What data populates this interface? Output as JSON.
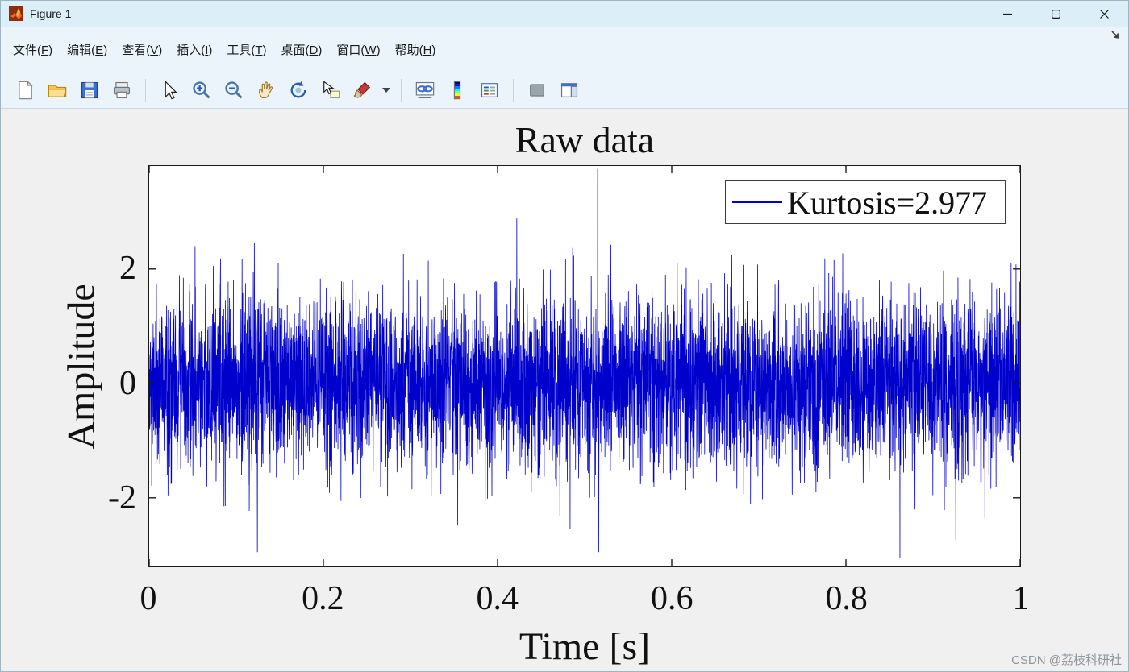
{
  "window": {
    "title": "Figure 1",
    "control_icons": [
      "minimize-icon",
      "maximize-icon",
      "close-icon"
    ],
    "app_icon": "matlab-logo-icon"
  },
  "menu": {
    "items": [
      {
        "pre": "文件(",
        "key": "F",
        "post": ")"
      },
      {
        "pre": "编辑(",
        "key": "E",
        "post": ")"
      },
      {
        "pre": "查看(",
        "key": "V",
        "post": ")"
      },
      {
        "pre": "插入(",
        "key": "I",
        "post": ")"
      },
      {
        "pre": "工具(",
        "key": "T",
        "post": ")"
      },
      {
        "pre": "桌面(",
        "key": "D",
        "post": ")"
      },
      {
        "pre": "窗口(",
        "key": "W",
        "post": ")"
      },
      {
        "pre": "帮助(",
        "key": "H",
        "post": ")"
      }
    ],
    "dock_icon": "dock-figure-icon"
  },
  "toolbar": {
    "icons": [
      "new-figure-icon",
      "open-file-icon",
      "save-figure-icon",
      "print-figure-icon",
      "edit-plot-icon",
      "zoom-in-icon",
      "zoom-out-icon",
      "pan-icon",
      "rotate-3d-icon",
      "data-cursor-icon",
      "brush-icon",
      "brush-dropdown-icon",
      "link-plot-icon",
      "insert-colorbar-icon",
      "insert-legend-icon",
      "hide-plot-tools-icon",
      "show-plot-tools-icon"
    ]
  },
  "watermark": "CSDN @荔枝科研社",
  "chart_data": {
    "type": "line",
    "title": "Raw data",
    "xlabel": "Time [s]",
    "ylabel": "Amplitude",
    "xlim": [
      0,
      1
    ],
    "ylim": [
      -3.2,
      3.8
    ],
    "xticks": [
      0,
      0.2,
      0.4,
      0.6,
      0.8,
      1
    ],
    "xtick_labels": [
      "0",
      "0.2",
      "0.4",
      "0.6",
      "0.8",
      "1"
    ],
    "yticks": [
      -2,
      0,
      2
    ],
    "ytick_labels": [
      "-2",
      "0",
      "2"
    ],
    "grid": false,
    "legend": [
      "Kurtosis=2.977"
    ],
    "legend_position": "northeast",
    "line_color": "#0000cc",
    "series": [
      {
        "name": "Kurtosis=2.977",
        "signal": "gaussian-noise",
        "n_points": 6000,
        "mean": 0,
        "std": 0.75,
        "kurtosis": 2.977,
        "max_peak": {
          "x": 0.515,
          "y": 3.75
        },
        "min_peak": {
          "x": 0.862,
          "y": -3.05
        }
      }
    ]
  }
}
